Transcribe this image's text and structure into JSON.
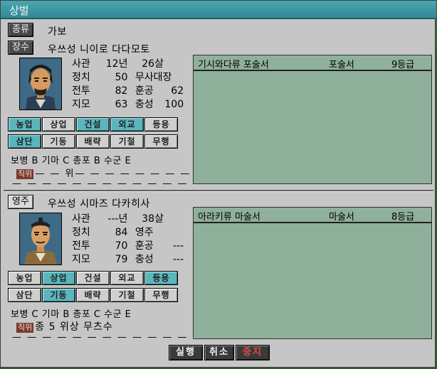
{
  "window": {
    "title": "상벌"
  },
  "top": {
    "kind_tag": "종류",
    "kind_value": "가보",
    "general_tag": "장수",
    "general_name": "우쓰성 니이로 다다모토",
    "stats": {
      "r1": {
        "label": "사관",
        "v1": "12년",
        "v2": "26살"
      },
      "r2": {
        "label": "정치",
        "v1": "50",
        "extra": "무사대장"
      },
      "r3": {
        "label": "전투",
        "v1": "82",
        "extra_label": "훈공",
        "extra_val": "62"
      },
      "r4": {
        "label": "지모",
        "v1": "63",
        "extra_label": "충성",
        "extra_val": "100"
      }
    },
    "skills_row1": [
      "농업",
      "상업",
      "건설",
      "외교",
      "등용"
    ],
    "skills_row2": [
      "삼단",
      "기동",
      "배략",
      "기철",
      "무행"
    ],
    "aptitude": "보병 B 기마 C 총포 B 수군 E",
    "rank_badge": "직위",
    "rank_text": "— — 위—  — — — — — — —",
    "bottom_dashes": "— —  — — —  — —  — —  — — — —",
    "item": {
      "name": "기시와다류 포술서",
      "type": "포술서",
      "grade": "9등급"
    }
  },
  "bottom": {
    "lord_tag": "영주",
    "lord_name": "우쓰성 시마즈 다카히사",
    "stats": {
      "r1": {
        "label": "사관",
        "v1": "---년",
        "v2": "38살"
      },
      "r2": {
        "label": "정치",
        "v1": "84",
        "extra": "영주"
      },
      "r3": {
        "label": "전투",
        "v1": "70",
        "extra_label": "훈공",
        "extra_val": "---"
      },
      "r4": {
        "label": "지모",
        "v1": "79",
        "extra_label": "충성",
        "extra_val": "---"
      }
    },
    "skills_row1": [
      "농업",
      "상업",
      "건설",
      "외교",
      "등용"
    ],
    "skills_row2": [
      "삼단",
      "기동",
      "배략",
      "기철",
      "무행"
    ],
    "aptitude": "보병 C 기마 B 총포 C 수군 E",
    "rank_badge": "직위",
    "rank_text": "종 5 위상 무츠수",
    "bottom_dashes": "— —  — — —  — —  — —  — — — —",
    "item": {
      "name": "아라키류 마술서",
      "type": "마술서",
      "grade": "8등급"
    }
  },
  "actions": {
    "execute": "실행",
    "cancel": "취소",
    "stop": "중지"
  },
  "colors": {
    "accent": "#5ab6bc",
    "title_bar": "#3a98a2",
    "panel": "#8fb09a",
    "stop": "#e04848"
  }
}
